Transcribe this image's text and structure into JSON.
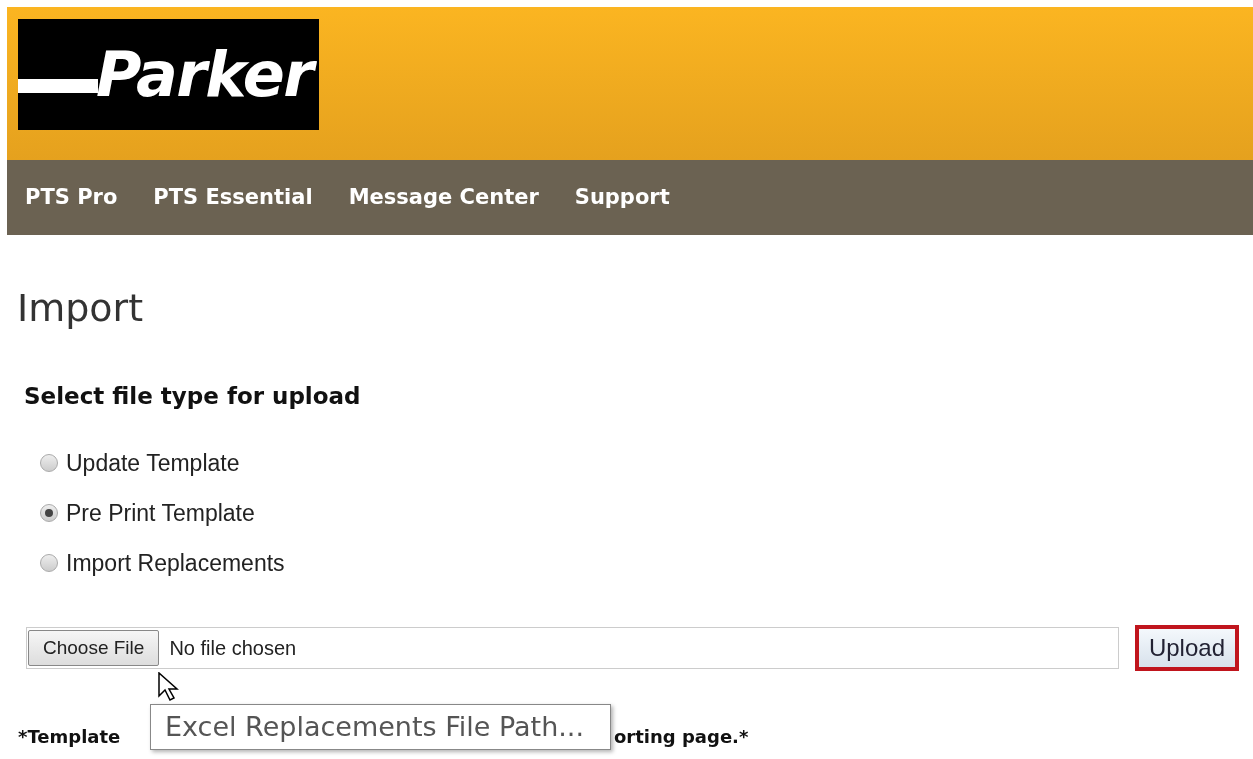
{
  "header": {
    "logo_text": "Parker"
  },
  "nav": {
    "items": [
      {
        "label": "PTS Pro"
      },
      {
        "label": "PTS Essential"
      },
      {
        "label": "Message Center"
      },
      {
        "label": "Support"
      }
    ]
  },
  "page_title": "Import",
  "section_title": "Select file type for upload",
  "options": [
    {
      "label": "Update Template",
      "selected": false
    },
    {
      "label": "Pre Print Template",
      "selected": true
    },
    {
      "label": "Import Replacements",
      "selected": false
    }
  ],
  "file_picker": {
    "button": "Choose File",
    "value": "No file chosen"
  },
  "upload_button": {
    "label": "Upload",
    "highlighted": true
  },
  "tooltip": "Excel Replacements File Path...",
  "note": {
    "start": "*Template",
    "end": "orting page.*"
  }
}
